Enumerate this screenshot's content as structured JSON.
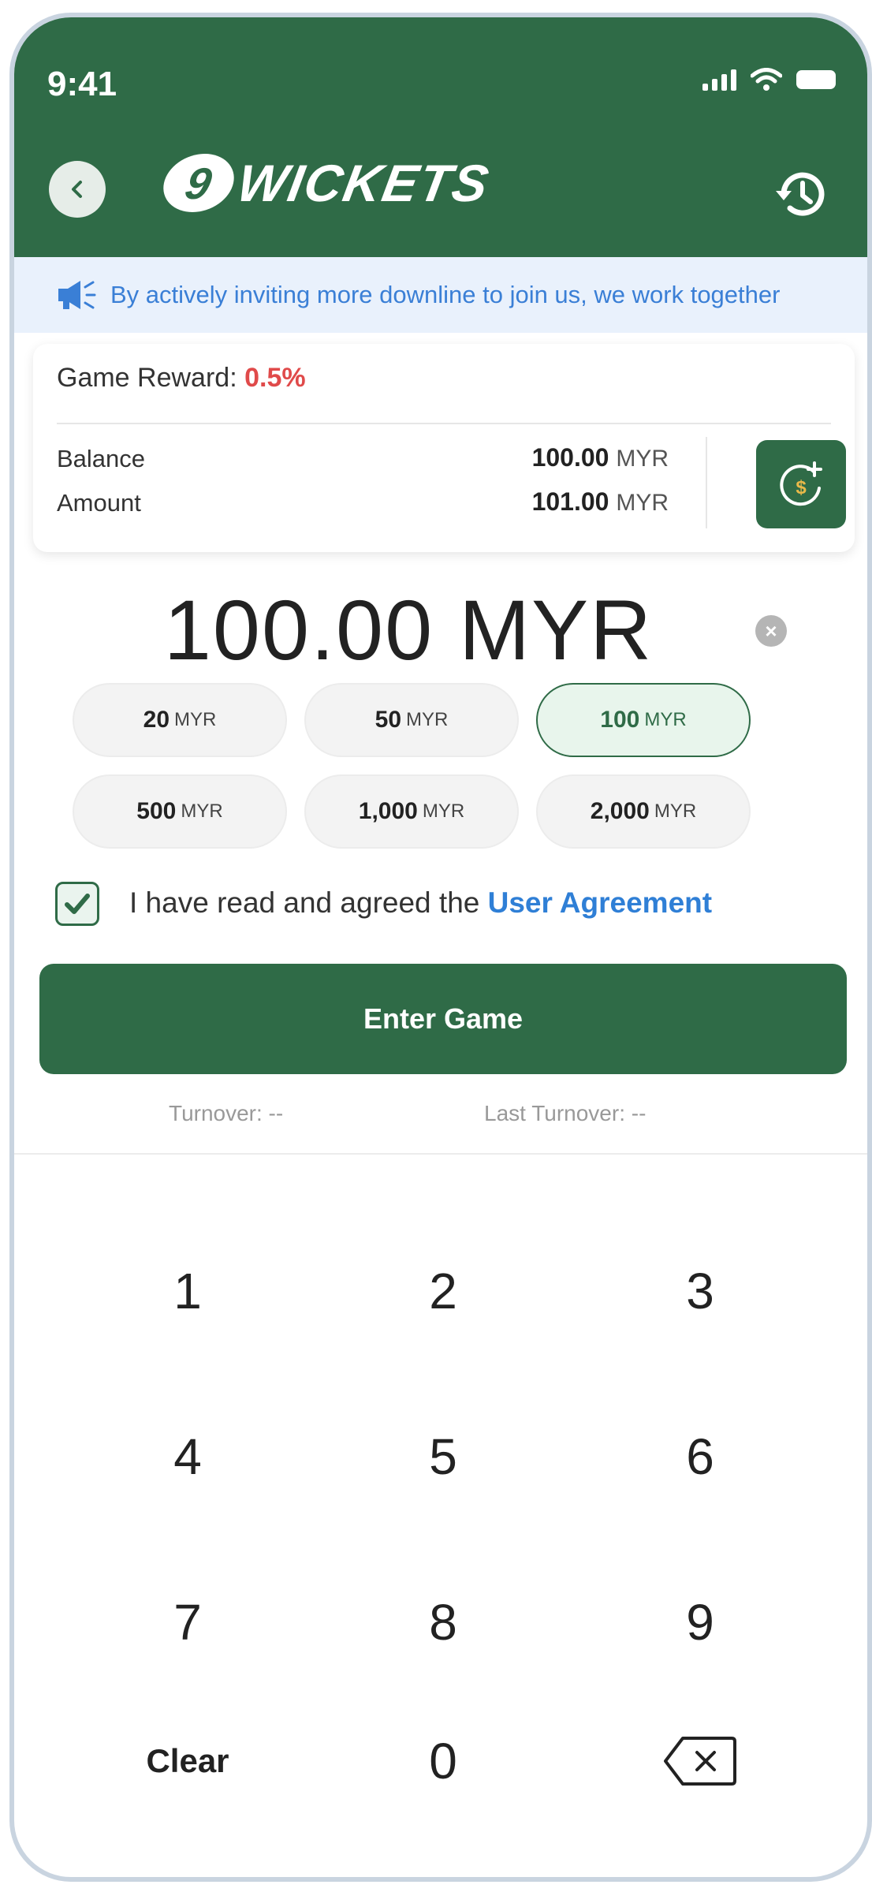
{
  "status_bar": {
    "time": "9:41"
  },
  "header": {
    "logo_badge": "9",
    "logo_text": "WICKETS",
    "back_icon": "chevron-left-icon",
    "history_icon": "history-icon",
    "bg_color": "#2f6b47"
  },
  "notice": {
    "icon": "megaphone-icon",
    "text": "By actively inviting more downline to join us, we work together"
  },
  "wallet": {
    "reward_label": "Game Reward:",
    "reward_value": "0.5%",
    "balance_label": "Balance",
    "balance_value": "100.00",
    "balance_currency": "MYR",
    "amount_label": "Amount",
    "amount_value": "101.00",
    "amount_currency": "MYR",
    "deposit_icon": "add-money-icon"
  },
  "amount_display": {
    "value": "100.00 MYR",
    "clear_symbol": "×"
  },
  "presets": [
    {
      "amount": "20",
      "currency": "MYR",
      "selected": false
    },
    {
      "amount": "50",
      "currency": "MYR",
      "selected": false
    },
    {
      "amount": "100",
      "currency": "MYR",
      "selected": true
    },
    {
      "amount": "500",
      "currency": "MYR",
      "selected": false
    },
    {
      "amount": "1,000",
      "currency": "MYR",
      "selected": false
    },
    {
      "amount": "2,000",
      "currency": "MYR",
      "selected": false
    }
  ],
  "agreement": {
    "checked": true,
    "text": "I have read and agreed the ",
    "link": "User Agreement"
  },
  "enter_button": "Enter Game",
  "turnover": {
    "label": "Turnover: --",
    "last_label": "Last Turnover: --"
  },
  "keypad": [
    "1",
    "2",
    "3",
    "4",
    "5",
    "6",
    "7",
    "8",
    "9",
    "Clear",
    "0",
    "backspace"
  ]
}
